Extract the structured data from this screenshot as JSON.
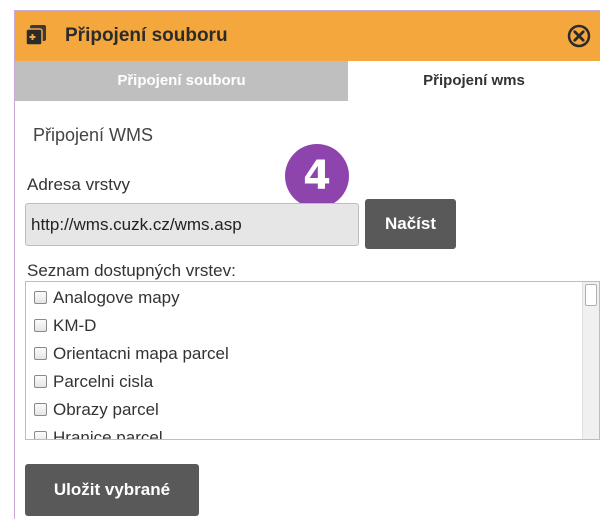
{
  "dialog": {
    "title": "Připojení souboru",
    "icon": "add-file-icon",
    "close_icon": "close-icon"
  },
  "tabs": [
    {
      "label": "Připojení souboru",
      "active": false
    },
    {
      "label": "Připojení wms",
      "active": true
    }
  ],
  "wms": {
    "section_title": "Připojení WMS",
    "step_badge": "4",
    "address_label": "Adresa vrstvy",
    "address_value": "http://wms.cuzk.cz/wms.asp",
    "load_button": "Načíst",
    "layers_label": "Seznam dostupných vrstev:",
    "layers": [
      {
        "label": "Analogove mapy",
        "checked": false
      },
      {
        "label": "KM-D",
        "checked": false
      },
      {
        "label": "Orientacni mapa parcel",
        "checked": false
      },
      {
        "label": "Parcelni cisla",
        "checked": false
      },
      {
        "label": "Obrazy parcel",
        "checked": false
      },
      {
        "label": "Hranice parcel",
        "checked": false
      }
    ],
    "save_button": "Uložit vybrané"
  },
  "colors": {
    "titlebar": "#f4a73c",
    "inactive_tab": "#bfbfbf",
    "button": "#595959",
    "badge": "#8e44ad"
  }
}
